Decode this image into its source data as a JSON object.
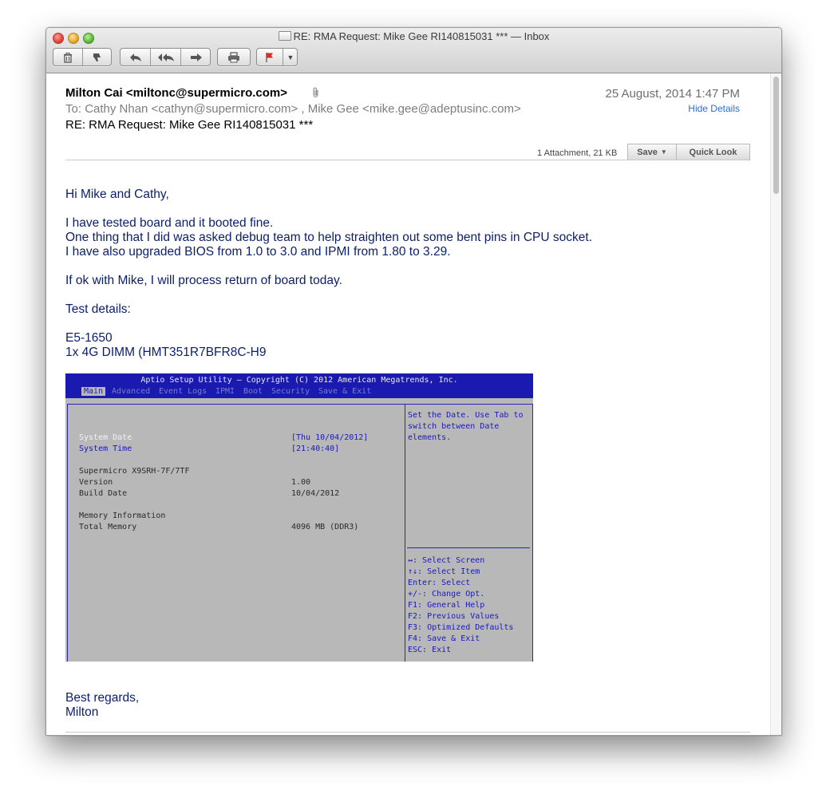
{
  "window": {
    "title": "RE: RMA Request: Mike Gee RI140815031 *** — Inbox"
  },
  "toolbar": {
    "delete_icon": "trash-icon",
    "junk_icon": "thumbs-down-icon",
    "reply_icon": "reply-icon",
    "reply_all_icon": "reply-all-icon",
    "forward_icon": "forward-icon",
    "print_icon": "printer-icon",
    "flag_icon": "flag-icon",
    "flag_color": "#d0312d"
  },
  "header": {
    "from": "Milton Cai <miltonc@supermicro.com>",
    "date": "25 August, 2014 1:47 PM",
    "hide_details": "Hide Details",
    "to_label": "To:",
    "to_recipients": "Cathy Nhan <cathyn@supermicro.com> ,  Mike Gee <mike.gee@adeptusinc.com>",
    "subject": "RE: RMA Request: Mike Gee RI140815031 ***",
    "attachment_info": "1 Attachment, 21 KB",
    "save_label": "Save",
    "quick_look_label": "Quick Look",
    "link_color": "#2a6ed8"
  },
  "body": {
    "greeting": "Hi Mike and Cathy,",
    "line1": "I have tested board and it booted fine.",
    "line2": "One thing that I did was asked debug team to help straighten out some bent pins in CPU socket.",
    "line3": "I have also upgraded BIOS from 1.0 to 3.0 and IPMI from 1.80 to 3.29.",
    "line4": "If ok with Mike, I will process return of board today.",
    "line5": "Test details:",
    "line6": "E5-1650",
    "line7": "1x 4G DIMM (HMT351R7BFR8C-H9",
    "closing1": "Best regards,",
    "closing2": "Milton",
    "text_color": "#0a1f6a"
  },
  "bios": {
    "title": "Aptio Setup Utility – Copyright (C) 2012 American Megatrends, Inc.",
    "menu": [
      "Main",
      "Advanced",
      "Event Logs",
      "IPMI",
      "Boot",
      "Security",
      "Save & Exit"
    ],
    "system_date_label": "System Date",
    "system_date_value": "[Thu 10/04/2012]",
    "system_time_label": "System Time",
    "system_time_value": "[21:40:40]",
    "board": "Supermicro X9SRH-7F/7TF",
    "version_label": "Version",
    "version_value": "1.00",
    "build_date_label": "Build Date",
    "build_date_value": "10/04/2012",
    "memory_info": "Memory Information",
    "total_memory_label": "Total Memory",
    "total_memory_value": "4096 MB (DDR3)",
    "help": [
      "Set the Date. Use Tab to",
      "switch between Date",
      "elements."
    ],
    "keys": [
      "↔: Select Screen",
      "↑↓: Select Item",
      "Enter: Select",
      "+/-: Change Opt.",
      "F1: General Help",
      "F2: Previous Values",
      "F3: Optimized Defaults",
      "F4: Save & Exit",
      "ESC: Exit"
    ],
    "header_color": "#1a1ab0",
    "background_color": "#b8b8b8"
  }
}
